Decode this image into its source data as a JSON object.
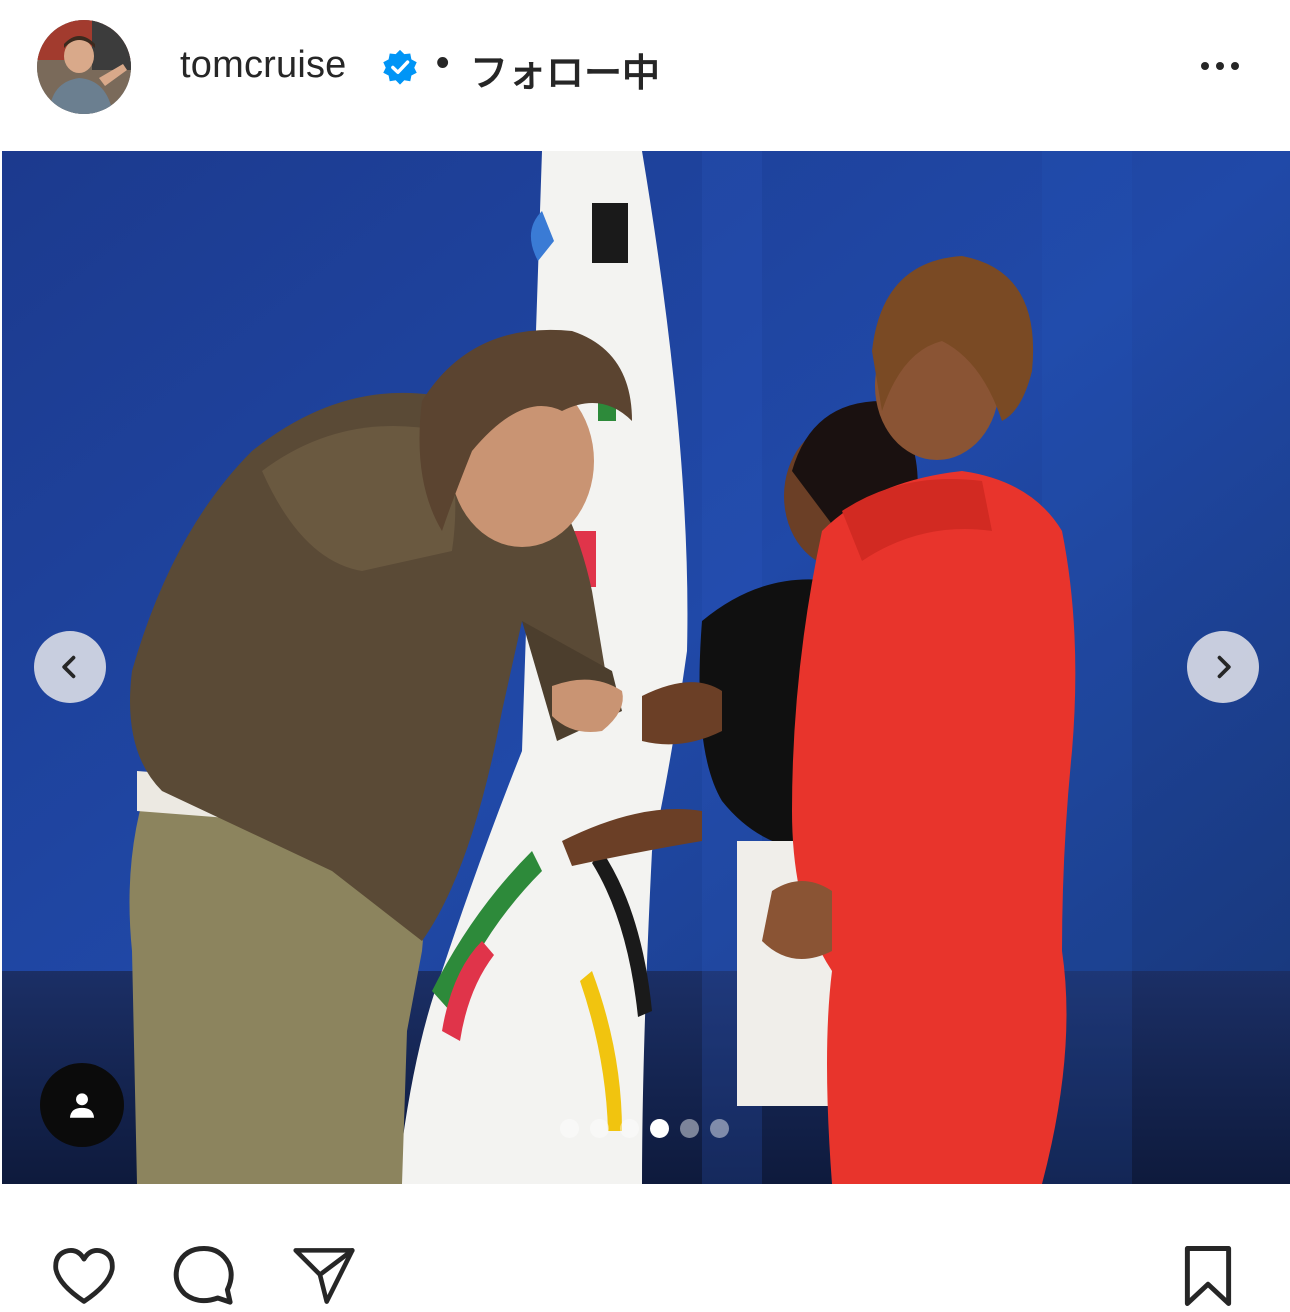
{
  "post": {
    "author": {
      "username": "tomcruise",
      "verified": true,
      "separator": "•",
      "follow_status": "フォロー中",
      "avatar_icon": "profile-photo"
    },
    "more_icon": "more-options-icon",
    "carousel": {
      "slide_count": 6,
      "active_slide": 4,
      "prev_icon": "chevron-left-icon",
      "next_icon": "chevron-right-icon",
      "tag_icon": "user-tag-icon"
    },
    "actions": {
      "like_icon": "heart-icon",
      "comment_icon": "comment-bubble-icon",
      "share_icon": "paper-plane-icon",
      "save_icon": "bookmark-icon"
    }
  },
  "colors": {
    "verified_badge": "#0095f6",
    "text_primary": "#262626",
    "stage_blue": "#1a3f9c"
  }
}
